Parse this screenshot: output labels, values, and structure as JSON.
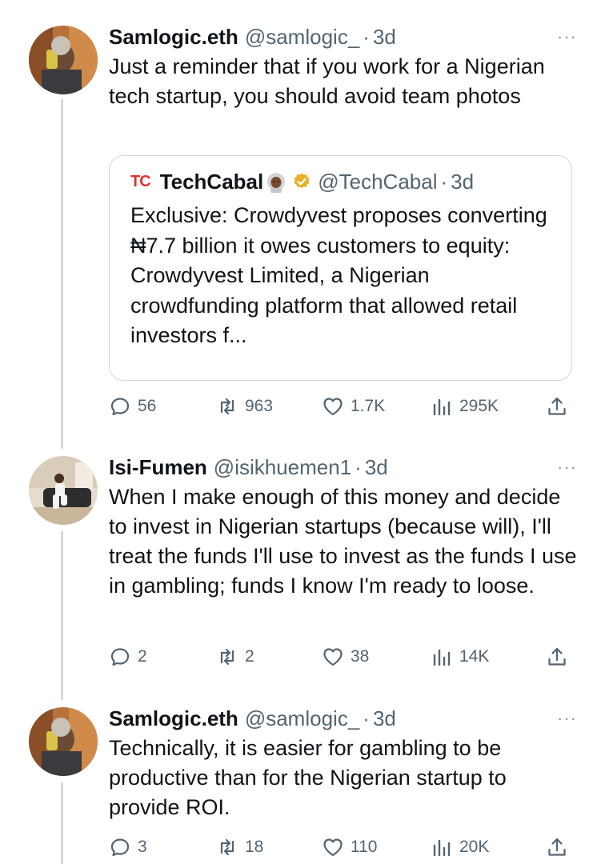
{
  "tweets": [
    {
      "name": "Samlogic.eth",
      "handle": "@samlogic_",
      "dot": "·",
      "time": "3d",
      "more": "···",
      "text": "Just a reminder that if you work for a Nigerian tech startup, you should avoid team photos",
      "quote": {
        "logo": "TC",
        "name": "TechCabal",
        "handle": "@TechCabal",
        "dot": "·",
        "time": "3d",
        "text": "Exclusive: Crowdyvest proposes converting ₦7.7 billion it owes customers to equity: Crowdyvest Limited, a Nigerian crowdfunding platform that allowed retail investors f..."
      },
      "stats": {
        "replies": "56",
        "retweets": "963",
        "likes": "1.7K",
        "views": "295K"
      }
    },
    {
      "name": "Isi-Fumen",
      "handle": "@isikhuemen1",
      "dot": "·",
      "time": "3d",
      "more": "···",
      "text": "When I make enough of this money and decide to invest in Nigerian startups (because will), I'll treat the funds I'll use to invest as the funds I use in gambling; funds I know I'm ready to loose.",
      "stats": {
        "replies": "2",
        "retweets": "2",
        "likes": "38",
        "views": "14K"
      }
    },
    {
      "name": "Samlogic.eth",
      "handle": "@samlogic_",
      "dot": "·",
      "time": "3d",
      "more": "···",
      "text": "Technically, it is easier for gambling to be productive than for the Nigerian startup to provide ROI.",
      "stats": {
        "replies": "3",
        "retweets": "18",
        "likes": "110",
        "views": "20K"
      }
    }
  ],
  "colors": {
    "text": "#0f1419",
    "secondary": "#536471",
    "border": "#cfd9de",
    "verified": "#e8b026",
    "brand": "#e0322f"
  },
  "icons": [
    "reply-icon",
    "retweet-icon",
    "like-icon",
    "views-icon",
    "share-icon",
    "verified-badge-icon",
    "astronaut-emoji-icon"
  ]
}
